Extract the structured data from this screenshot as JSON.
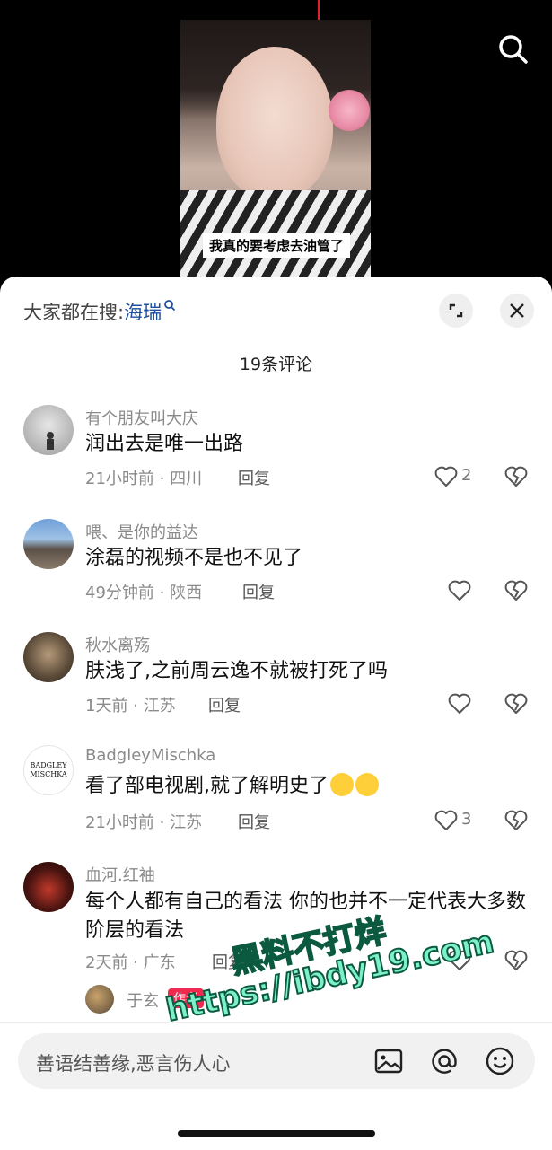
{
  "video": {
    "caption": "我真的要考虑去油管了"
  },
  "sheet": {
    "trending_label": "大家都在搜:",
    "trending_keyword": "海瑞",
    "comment_count": "19条评论"
  },
  "comments": [
    {
      "user": "有个朋友叫大庆",
      "text": "润出去是唯一出路",
      "time_location": "21小时前 · 四川",
      "reply": "回复",
      "likes": "2"
    },
    {
      "user": "喂、是你的益达",
      "text": "涂磊的视频不是也不见了",
      "time_location": "49分钟前 · 陕西",
      "reply": "回复",
      "likes": ""
    },
    {
      "user": "秋水离殇",
      "text": "肤浅了,之前周云逸不就被打死了吗",
      "time_location": "1天前 · 江苏",
      "reply": "回复",
      "likes": ""
    },
    {
      "user": "BadgleyMischka",
      "text": "看了部电视剧,就了解明史了",
      "time_location": "21小时前 · 江苏",
      "reply": "回复",
      "likes": "3",
      "avatar_text": "BADGLEY MISCHKA"
    },
    {
      "user": "血河.红袖",
      "text": "每个人都有自己的看法 你的也并不一定代表大多数阶层的看法",
      "time_location": "2天前 · 广东",
      "reply": "回复",
      "likes": ""
    }
  ],
  "sub_reply": {
    "user": "于玄",
    "badge": "作者"
  },
  "watermark": {
    "line1": "黑料不打烊",
    "line2": "https://ibdy19.com"
  },
  "input": {
    "placeholder": "善语结善缘,恶言伤人心"
  },
  "colors": {
    "link_blue": "#1c4f9c",
    "author_badge": "#f0294f"
  }
}
